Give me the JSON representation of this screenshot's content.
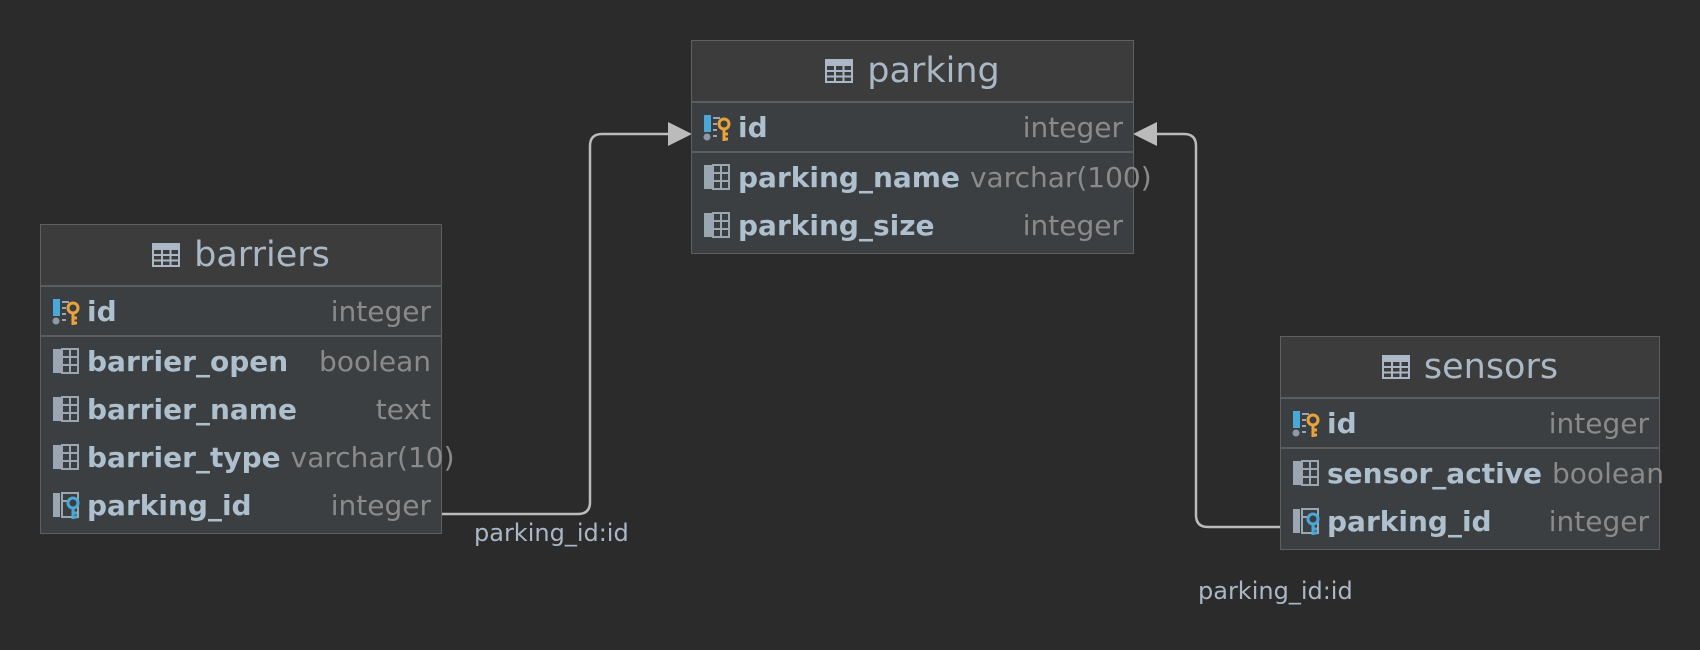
{
  "colors": {
    "background": "#2b2b2b",
    "table_body": "#3c3f41",
    "table_header": "#3c3c3c",
    "edge": "#bbbbbb",
    "key_gold": "#e8a33b",
    "key_blue": "#4aa8d8"
  },
  "tables": {
    "parking": {
      "title": "parking",
      "columns": [
        {
          "name": "id",
          "type": "integer",
          "icon": "primary-key-column-icon"
        },
        {
          "name": "parking_name",
          "type": "varchar(100)",
          "icon": "column-icon"
        },
        {
          "name": "parking_size",
          "type": "integer",
          "icon": "column-icon"
        }
      ]
    },
    "barriers": {
      "title": "barriers",
      "columns": [
        {
          "name": "id",
          "type": "integer",
          "icon": "primary-key-column-icon"
        },
        {
          "name": "barrier_open",
          "type": "boolean",
          "icon": "column-icon"
        },
        {
          "name": "barrier_name",
          "type": "text",
          "icon": "column-icon"
        },
        {
          "name": "barrier_type",
          "type": "varchar(10)",
          "icon": "column-icon"
        },
        {
          "name": "parking_id",
          "type": "integer",
          "icon": "foreign-key-column-icon"
        }
      ]
    },
    "sensors": {
      "title": "sensors",
      "columns": [
        {
          "name": "id",
          "type": "integer",
          "icon": "primary-key-column-icon"
        },
        {
          "name": "sensor_active",
          "type": "boolean",
          "icon": "column-icon"
        },
        {
          "name": "parking_id",
          "type": "integer",
          "icon": "foreign-key-column-icon"
        }
      ]
    }
  },
  "relations": [
    {
      "label": "parking_id:id",
      "from": "barriers.parking_id",
      "to": "parking.id"
    },
    {
      "label": "parking_id:id",
      "from": "sensors.parking_id",
      "to": "parking.id"
    }
  ]
}
